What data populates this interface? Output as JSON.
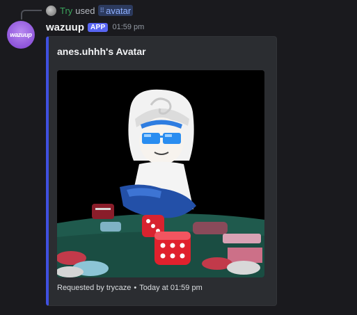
{
  "reply": {
    "user": "Try",
    "action": "used",
    "command": "avatar",
    "command_icon": "slash-command-icon"
  },
  "message": {
    "avatar_text": "wazuup",
    "username": "wazuup",
    "badge": "APP",
    "time": "01:59 pm"
  },
  "embed": {
    "title": "anes.uhhh's Avatar",
    "accent_color": "#3f50e0",
    "footer": {
      "requested_by": "Requested by trycaze",
      "separator": "•",
      "timestamp": "Today at 01:59 pm"
    }
  },
  "colors": {
    "background": "#1a1a1e",
    "embed_bg": "#2b2d31",
    "badge": "#5865f2",
    "reply_user": "#3ba55d"
  }
}
